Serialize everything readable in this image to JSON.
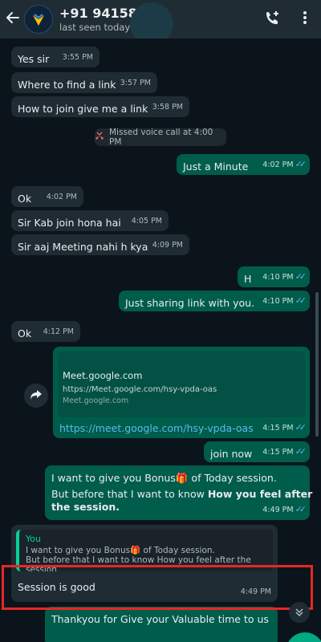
{
  "header": {
    "contact_name": "+91 94158 6",
    "last_seen": "last seen today at"
  },
  "messages": [
    {
      "text": "Yes sir",
      "time": "3:55 PM"
    },
    {
      "text": "Where to find a link",
      "time": "3:57 PM"
    },
    {
      "text": "How to join give me a link",
      "time": "3:58 PM"
    },
    {
      "text": "Just a Minute",
      "time": "4:02 PM"
    },
    {
      "text": "Ok",
      "time": "4:02 PM"
    },
    {
      "text": "Sir Kab join hona hai",
      "time": "4:05 PM"
    },
    {
      "text": "Sir aaj Meeting nahi h kya",
      "time": "4:09 PM"
    },
    {
      "text": "H",
      "time": "4:10 PM"
    },
    {
      "text": "Just sharing link with you.",
      "time": "4:10 PM"
    },
    {
      "text": "Ok",
      "time": "4:12 PM"
    },
    {
      "text": "https://meet.google.com/hsy-vpda-oas",
      "time": "4:15 PM"
    },
    {
      "text": "join now",
      "time": "4:15 PM"
    },
    {
      "text_1": "I want to give you Bonus",
      "text_2": "of Today session.",
      "text_3": "But before that I want to know",
      "text_bold": "How you feel after",
      "text_bold2": "the session.",
      "time": "4:49 PM"
    },
    {
      "text": "Session is good",
      "time": "4:49 PM"
    },
    {
      "text": "Thankyou for Give your Valuable time to us"
    }
  ],
  "system": {
    "missed_call": "Missed voice call at 4:00 PM"
  },
  "link_preview": {
    "title": "Meet.google.com",
    "description": "https://Meet.google.com/hsy-vpda-oas",
    "domain": "Meet.google.com"
  },
  "quote": {
    "author": "You",
    "line1": "I want to give you Bonus",
    "line1b": "of Today session.",
    "line2": "But before that I want to know How you feel after the",
    "line3": "session."
  },
  "icons": {
    "back": "arrow-left-icon",
    "avatar": "avatar-logo",
    "add_call": "phone-plus-icon",
    "menu": "vertical-dots-icon",
    "missed_call": "missed-call-icon",
    "share": "share-arrow-icon",
    "gift": "gift-emoji-icon",
    "scroll_down": "double-chevron-down-icon",
    "read_receipt": "double-check-icon"
  },
  "colors": {
    "header_bg": "#1f2c34",
    "chat_bg": "#0b141a",
    "incoming": "#202c33",
    "outgoing": "#005c4b",
    "tick": "#53bdeb",
    "accent": "#00a884",
    "highlight": "#e62727"
  }
}
